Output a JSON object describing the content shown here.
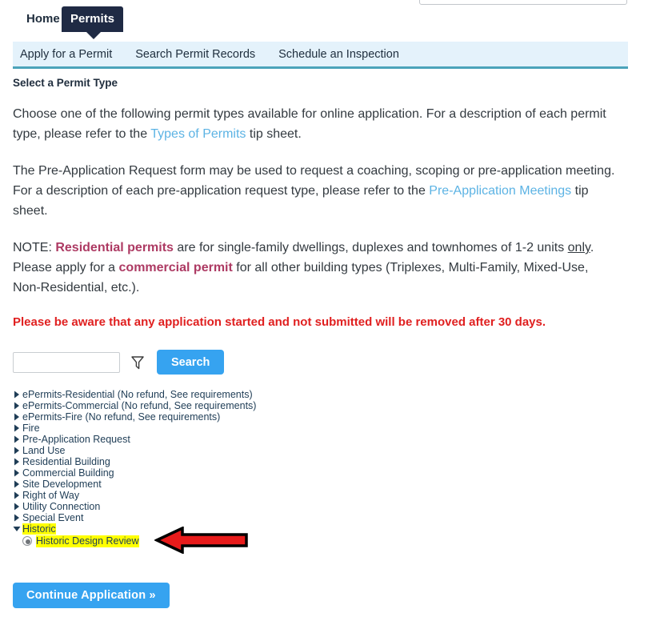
{
  "top_search_field": {
    "value": "",
    "placeholder": ""
  },
  "primary_tabs": [
    {
      "label": "Home",
      "active": false
    },
    {
      "label": "Permits",
      "active": true
    }
  ],
  "sub_nav": [
    {
      "label": "Apply for a Permit"
    },
    {
      "label": "Search Permit Records"
    },
    {
      "label": "Schedule an Inspection"
    }
  ],
  "main": {
    "section_title": "Select a Permit Type",
    "paragraph1": {
      "part1": "Choose one of the following permit types available for online application. For a description of each permit type, please refer to the ",
      "link": "Types of Permits",
      "part2": " tip sheet."
    },
    "paragraph2": {
      "part1": "The Pre-Application Request form may be used to request a coaching, scoping or pre-application meeting. For a description of each pre-application request type, please refer to the ",
      "link": "Pre-Application Meetings",
      "part2": " tip sheet."
    },
    "paragraph3": {
      "part1": "NOTE: ",
      "highlight1": "Residential permits",
      "part2": " are for single-family dwellings, duplexes and townhomes of 1-2 units ",
      "underlined": "only",
      "part3": ". Please apply for a ",
      "highlight2": "commercial permit",
      "part4": " for all other building types (Triplexes, Multi-Family, Mixed-Use, Non-Residential, etc.)."
    },
    "warning": "Please be aware that any application started and not submitted will be removed after 30 days."
  },
  "search": {
    "input_value": "",
    "input_placeholder": "",
    "filter_icon": "funnel-icon",
    "button_label": "Search"
  },
  "permit_tree": [
    {
      "label": "ePermits-Residential (No refund, See requirements)",
      "expanded": false
    },
    {
      "label": "ePermits-Commercial (No refund, See requirements)",
      "expanded": false
    },
    {
      "label": "ePermits-Fire (No refund, See requirements)",
      "expanded": false
    },
    {
      "label": "Fire",
      "expanded": false
    },
    {
      "label": "Pre-Application Request",
      "expanded": false
    },
    {
      "label": "Land Use",
      "expanded": false
    },
    {
      "label": "Residential Building",
      "expanded": false
    },
    {
      "label": "Commercial Building",
      "expanded": false
    },
    {
      "label": "Site Development",
      "expanded": false
    },
    {
      "label": "Right of Way",
      "expanded": false
    },
    {
      "label": "Utility Connection",
      "expanded": false
    },
    {
      "label": "Special Event",
      "expanded": false
    },
    {
      "label": "Historic",
      "expanded": true
    }
  ],
  "selected_child": {
    "label": "Historic Design Review",
    "selected": true
  },
  "annotation": {
    "type": "red-left-arrow",
    "fill": "#e81b1b",
    "stroke": "#000000"
  },
  "continue": {
    "label": "Continue Application »"
  },
  "colors": {
    "tab_active_bg": "#1f2a44",
    "subnav_bg": "#e4f2fb",
    "subnav_border": "#4ba3ba",
    "link": "#5cb3e4",
    "magenta": "#ad3a63",
    "warning_red": "#e02020",
    "button_blue": "#36a3f0",
    "highlight_yellow": "#ffff00",
    "tree_text": "#1f3d56"
  }
}
